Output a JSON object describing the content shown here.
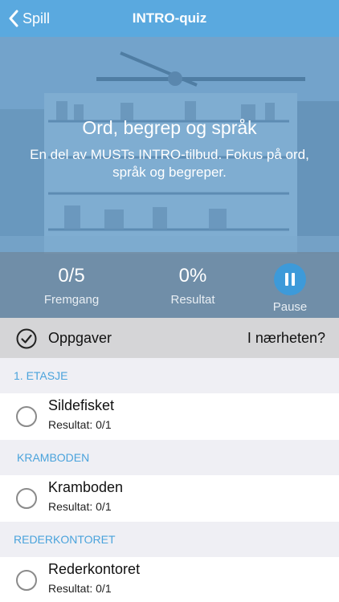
{
  "nav": {
    "back_label": "Spill",
    "title": "INTRO-quiz"
  },
  "hero": {
    "title": "Ord, begrep og språk",
    "description": "En del av MUSTs INTRO-tilbud. Fokus på ord, språk og begreper."
  },
  "stats": {
    "progress_value": "0/5",
    "progress_label": "Fremgang",
    "result_value": "0%",
    "result_label": "Resultat",
    "pause_label": "Pause"
  },
  "filter": {
    "tasks_label": "Oppgaver",
    "nearby_label": "I nærheten?"
  },
  "sections": [
    {
      "header": "1. ETASJE",
      "items": [
        {
          "title": "Sildefisket",
          "subtitle": "Resultat: 0/1"
        }
      ]
    },
    {
      "header": "KRAMBODEN",
      "items": [
        {
          "title": "Kramboden",
          "subtitle": "Resultat: 0/1"
        }
      ]
    },
    {
      "header": "REDERKONTORET",
      "items": [
        {
          "title": "Rederkontoret",
          "subtitle": "Resultat: 0/1"
        }
      ]
    }
  ],
  "colors": {
    "navbar": "#5aa9df",
    "accent": "#4aa3dc",
    "pause_button": "#3d9ad9"
  }
}
